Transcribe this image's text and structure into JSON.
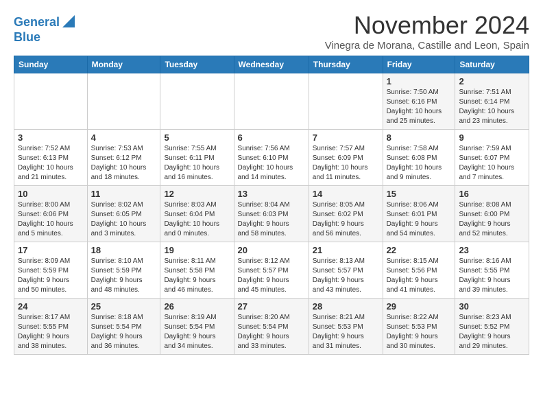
{
  "logo": {
    "line1": "General",
    "line2": "Blue"
  },
  "title": "November 2024",
  "subtitle": "Vinegra de Morana, Castille and Leon, Spain",
  "days_header": [
    "Sunday",
    "Monday",
    "Tuesday",
    "Wednesday",
    "Thursday",
    "Friday",
    "Saturday"
  ],
  "weeks": [
    [
      {
        "day": "",
        "info": ""
      },
      {
        "day": "",
        "info": ""
      },
      {
        "day": "",
        "info": ""
      },
      {
        "day": "",
        "info": ""
      },
      {
        "day": "",
        "info": ""
      },
      {
        "day": "1",
        "info": "Sunrise: 7:50 AM\nSunset: 6:16 PM\nDaylight: 10 hours\nand 25 minutes."
      },
      {
        "day": "2",
        "info": "Sunrise: 7:51 AM\nSunset: 6:14 PM\nDaylight: 10 hours\nand 23 minutes."
      }
    ],
    [
      {
        "day": "3",
        "info": "Sunrise: 7:52 AM\nSunset: 6:13 PM\nDaylight: 10 hours\nand 21 minutes."
      },
      {
        "day": "4",
        "info": "Sunrise: 7:53 AM\nSunset: 6:12 PM\nDaylight: 10 hours\nand 18 minutes."
      },
      {
        "day": "5",
        "info": "Sunrise: 7:55 AM\nSunset: 6:11 PM\nDaylight: 10 hours\nand 16 minutes."
      },
      {
        "day": "6",
        "info": "Sunrise: 7:56 AM\nSunset: 6:10 PM\nDaylight: 10 hours\nand 14 minutes."
      },
      {
        "day": "7",
        "info": "Sunrise: 7:57 AM\nSunset: 6:09 PM\nDaylight: 10 hours\nand 11 minutes."
      },
      {
        "day": "8",
        "info": "Sunrise: 7:58 AM\nSunset: 6:08 PM\nDaylight: 10 hours\nand 9 minutes."
      },
      {
        "day": "9",
        "info": "Sunrise: 7:59 AM\nSunset: 6:07 PM\nDaylight: 10 hours\nand 7 minutes."
      }
    ],
    [
      {
        "day": "10",
        "info": "Sunrise: 8:00 AM\nSunset: 6:06 PM\nDaylight: 10 hours\nand 5 minutes."
      },
      {
        "day": "11",
        "info": "Sunrise: 8:02 AM\nSunset: 6:05 PM\nDaylight: 10 hours\nand 3 minutes."
      },
      {
        "day": "12",
        "info": "Sunrise: 8:03 AM\nSunset: 6:04 PM\nDaylight: 10 hours\nand 0 minutes."
      },
      {
        "day": "13",
        "info": "Sunrise: 8:04 AM\nSunset: 6:03 PM\nDaylight: 9 hours\nand 58 minutes."
      },
      {
        "day": "14",
        "info": "Sunrise: 8:05 AM\nSunset: 6:02 PM\nDaylight: 9 hours\nand 56 minutes."
      },
      {
        "day": "15",
        "info": "Sunrise: 8:06 AM\nSunset: 6:01 PM\nDaylight: 9 hours\nand 54 minutes."
      },
      {
        "day": "16",
        "info": "Sunrise: 8:08 AM\nSunset: 6:00 PM\nDaylight: 9 hours\nand 52 minutes."
      }
    ],
    [
      {
        "day": "17",
        "info": "Sunrise: 8:09 AM\nSunset: 5:59 PM\nDaylight: 9 hours\nand 50 minutes."
      },
      {
        "day": "18",
        "info": "Sunrise: 8:10 AM\nSunset: 5:59 PM\nDaylight: 9 hours\nand 48 minutes."
      },
      {
        "day": "19",
        "info": "Sunrise: 8:11 AM\nSunset: 5:58 PM\nDaylight: 9 hours\nand 46 minutes."
      },
      {
        "day": "20",
        "info": "Sunrise: 8:12 AM\nSunset: 5:57 PM\nDaylight: 9 hours\nand 45 minutes."
      },
      {
        "day": "21",
        "info": "Sunrise: 8:13 AM\nSunset: 5:57 PM\nDaylight: 9 hours\nand 43 minutes."
      },
      {
        "day": "22",
        "info": "Sunrise: 8:15 AM\nSunset: 5:56 PM\nDaylight: 9 hours\nand 41 minutes."
      },
      {
        "day": "23",
        "info": "Sunrise: 8:16 AM\nSunset: 5:55 PM\nDaylight: 9 hours\nand 39 minutes."
      }
    ],
    [
      {
        "day": "24",
        "info": "Sunrise: 8:17 AM\nSunset: 5:55 PM\nDaylight: 9 hours\nand 38 minutes."
      },
      {
        "day": "25",
        "info": "Sunrise: 8:18 AM\nSunset: 5:54 PM\nDaylight: 9 hours\nand 36 minutes."
      },
      {
        "day": "26",
        "info": "Sunrise: 8:19 AM\nSunset: 5:54 PM\nDaylight: 9 hours\nand 34 minutes."
      },
      {
        "day": "27",
        "info": "Sunrise: 8:20 AM\nSunset: 5:54 PM\nDaylight: 9 hours\nand 33 minutes."
      },
      {
        "day": "28",
        "info": "Sunrise: 8:21 AM\nSunset: 5:53 PM\nDaylight: 9 hours\nand 31 minutes."
      },
      {
        "day": "29",
        "info": "Sunrise: 8:22 AM\nSunset: 5:53 PM\nDaylight: 9 hours\nand 30 minutes."
      },
      {
        "day": "30",
        "info": "Sunrise: 8:23 AM\nSunset: 5:52 PM\nDaylight: 9 hours\nand 29 minutes."
      }
    ]
  ]
}
